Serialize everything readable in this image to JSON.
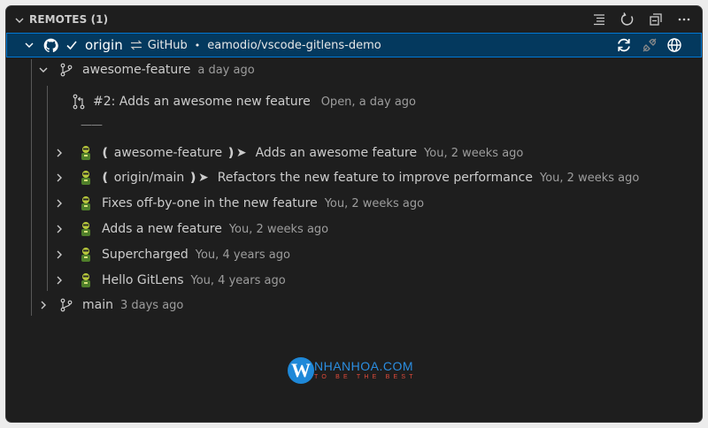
{
  "section": {
    "title": "REMOTES (1)"
  },
  "remote": {
    "name": "origin",
    "provider": "GitHub",
    "repo": "eamodio/vscode-gitlens-demo",
    "bullet": "•"
  },
  "branch_awesome": {
    "name": "awesome-feature",
    "time": "a day ago"
  },
  "pull_request": {
    "title": "#2: Adds an awesome new feature",
    "status": "Open, a day ago"
  },
  "separator": "——",
  "commits": [
    {
      "ref_open": "❪",
      "ref": "awesome-feature",
      "ref_close": "❫➤",
      "message": "Adds an awesome feature",
      "meta": "You, 2 weeks ago"
    },
    {
      "ref_open": "❪",
      "ref": "origin/main",
      "ref_close": "❫➤",
      "message": "Refactors the new feature to improve performance",
      "meta": "You, 2 weeks ago"
    },
    {
      "message": "Fixes off-by-one in the new feature",
      "meta": "You, 2 weeks ago"
    },
    {
      "message": "Adds a new feature",
      "meta": "You, 2 weeks ago"
    },
    {
      "message": "Supercharged",
      "meta": "You, 4 years ago"
    },
    {
      "message": "Hello GitLens",
      "meta": "You, 4 years ago"
    }
  ],
  "branch_main": {
    "name": "main",
    "time": "3 days ago"
  },
  "watermark": {
    "brand": "NHANHOA.COM",
    "tagline": "TO BE THE BEST",
    "letter": "W"
  },
  "icons": {
    "header": [
      "list-tree-icon",
      "refresh-icon",
      "collapse-all-icon",
      "more-icon"
    ],
    "remote": [
      "sync-icon",
      "unplug-icon",
      "globe-icon"
    ]
  },
  "colors": {
    "selected_bg": "#04395e",
    "selected_border": "#0078d4",
    "background": "#1e1e1e",
    "description": "#9d9d9d"
  }
}
